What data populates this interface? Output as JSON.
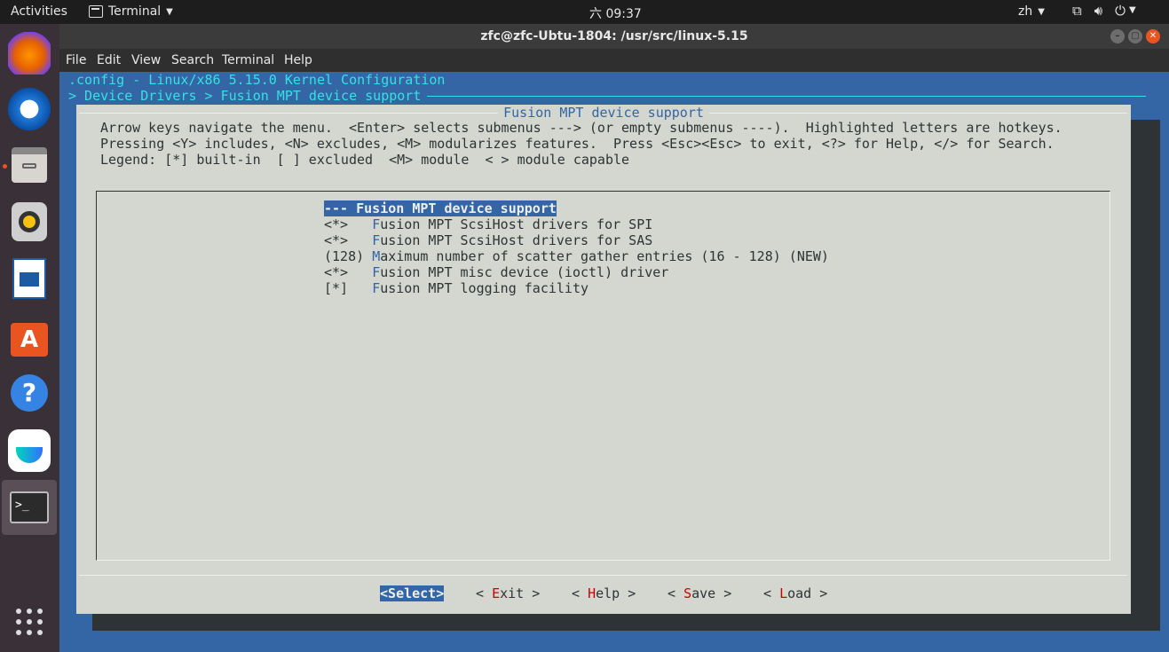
{
  "topbar": {
    "activities": "Activities",
    "app_name": "Terminal",
    "clock": "六 09:37",
    "lang": "zh"
  },
  "dock": {
    "items": [
      "firefox-icon",
      "thunderbird-icon",
      "files-icon",
      "rhythmbox-icon",
      "writer-icon",
      "software-icon",
      "help-icon",
      "feishu-icon",
      "terminal-icon"
    ],
    "apps_grid": "show-apps-icon",
    "accent": "#e95420"
  },
  "window": {
    "title": "zfc@zfc-Ubtu-1804: /usr/src/linux-5.15",
    "menu": [
      "File",
      "Edit",
      "View",
      "Search",
      "Terminal",
      "Help"
    ]
  },
  "terminal": {
    "header_line1": ".config - Linux/x86 5.15.0 Kernel Configuration",
    "header_line2": "> Device Drivers > Fusion MPT device support ",
    "dialog_title": "Fusion MPT device support",
    "help_lines": [
      "Arrow keys navigate the menu.  <Enter> selects submenus ---> (or empty submenus ----).  Highlighted letters are hotkeys.",
      "Pressing <Y> includes, <N> excludes, <M> modularizes features.  Press <Esc><Esc> to exit, <?> for Help, </> for Search.",
      "Legend: [*] built-in  [ ] excluded  <M> module  < > module capable"
    ],
    "items": [
      {
        "prefix": "--- ",
        "hotkey": "",
        "rest": "Fusion MPT device support",
        "selected": true
      },
      {
        "prefix": "<*>   ",
        "hotkey": "F",
        "rest": "usion MPT ScsiHost drivers for SPI"
      },
      {
        "prefix": "<*>   ",
        "hotkey": "F",
        "rest": "usion MPT ScsiHost drivers for SAS"
      },
      {
        "prefix": "(128) ",
        "hotkey": "M",
        "rest": "aximum number of scatter gather entries (16 - 128) (NEW)"
      },
      {
        "prefix": "<*>   ",
        "hotkey": "F",
        "rest": "usion MPT misc device (ioctl) driver"
      },
      {
        "prefix": "[*]   ",
        "hotkey": "F",
        "rest": "usion MPT logging facility"
      }
    ],
    "buttons": [
      {
        "pre": "<",
        "hotkey": "S",
        "rest": "elect>",
        "selected": true
      },
      {
        "pre": "< ",
        "hotkey": "E",
        "rest": "xit >"
      },
      {
        "pre": "< ",
        "hotkey": "H",
        "rest": "elp >"
      },
      {
        "pre": "< ",
        "hotkey": "S",
        "rest": "ave >"
      },
      {
        "pre": "< ",
        "hotkey": "L",
        "rest": "oad >"
      }
    ],
    "colors": {
      "background": "#3465a4",
      "dialog": "#d3d7cf",
      "header": "#34e2e2",
      "hotkey": "#cc0000"
    }
  }
}
